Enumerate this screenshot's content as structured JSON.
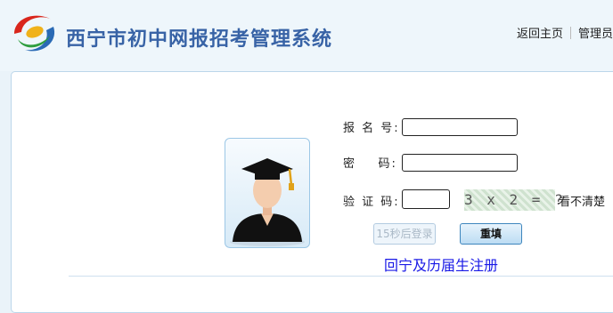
{
  "header": {
    "site_title": "西宁市初中网报招考管理系统",
    "nav": [
      "返回主页",
      "管理员"
    ]
  },
  "login_form": {
    "id_label": "报 名 号:",
    "id_value": "",
    "password_label": "密    码:",
    "password_value": "",
    "captcha_label": "验 证 码:",
    "captcha_value": "",
    "captcha_image_text": "3 x 2 = ?",
    "unclear_link": "看不清楚",
    "login_button": "15秒后登录",
    "reset_button": "重填",
    "register_link": "回宁及历届生注册"
  },
  "colors": {
    "title": "#3863a6",
    "link": "#1a1ae6",
    "panel_border": "#bcd6ea"
  }
}
